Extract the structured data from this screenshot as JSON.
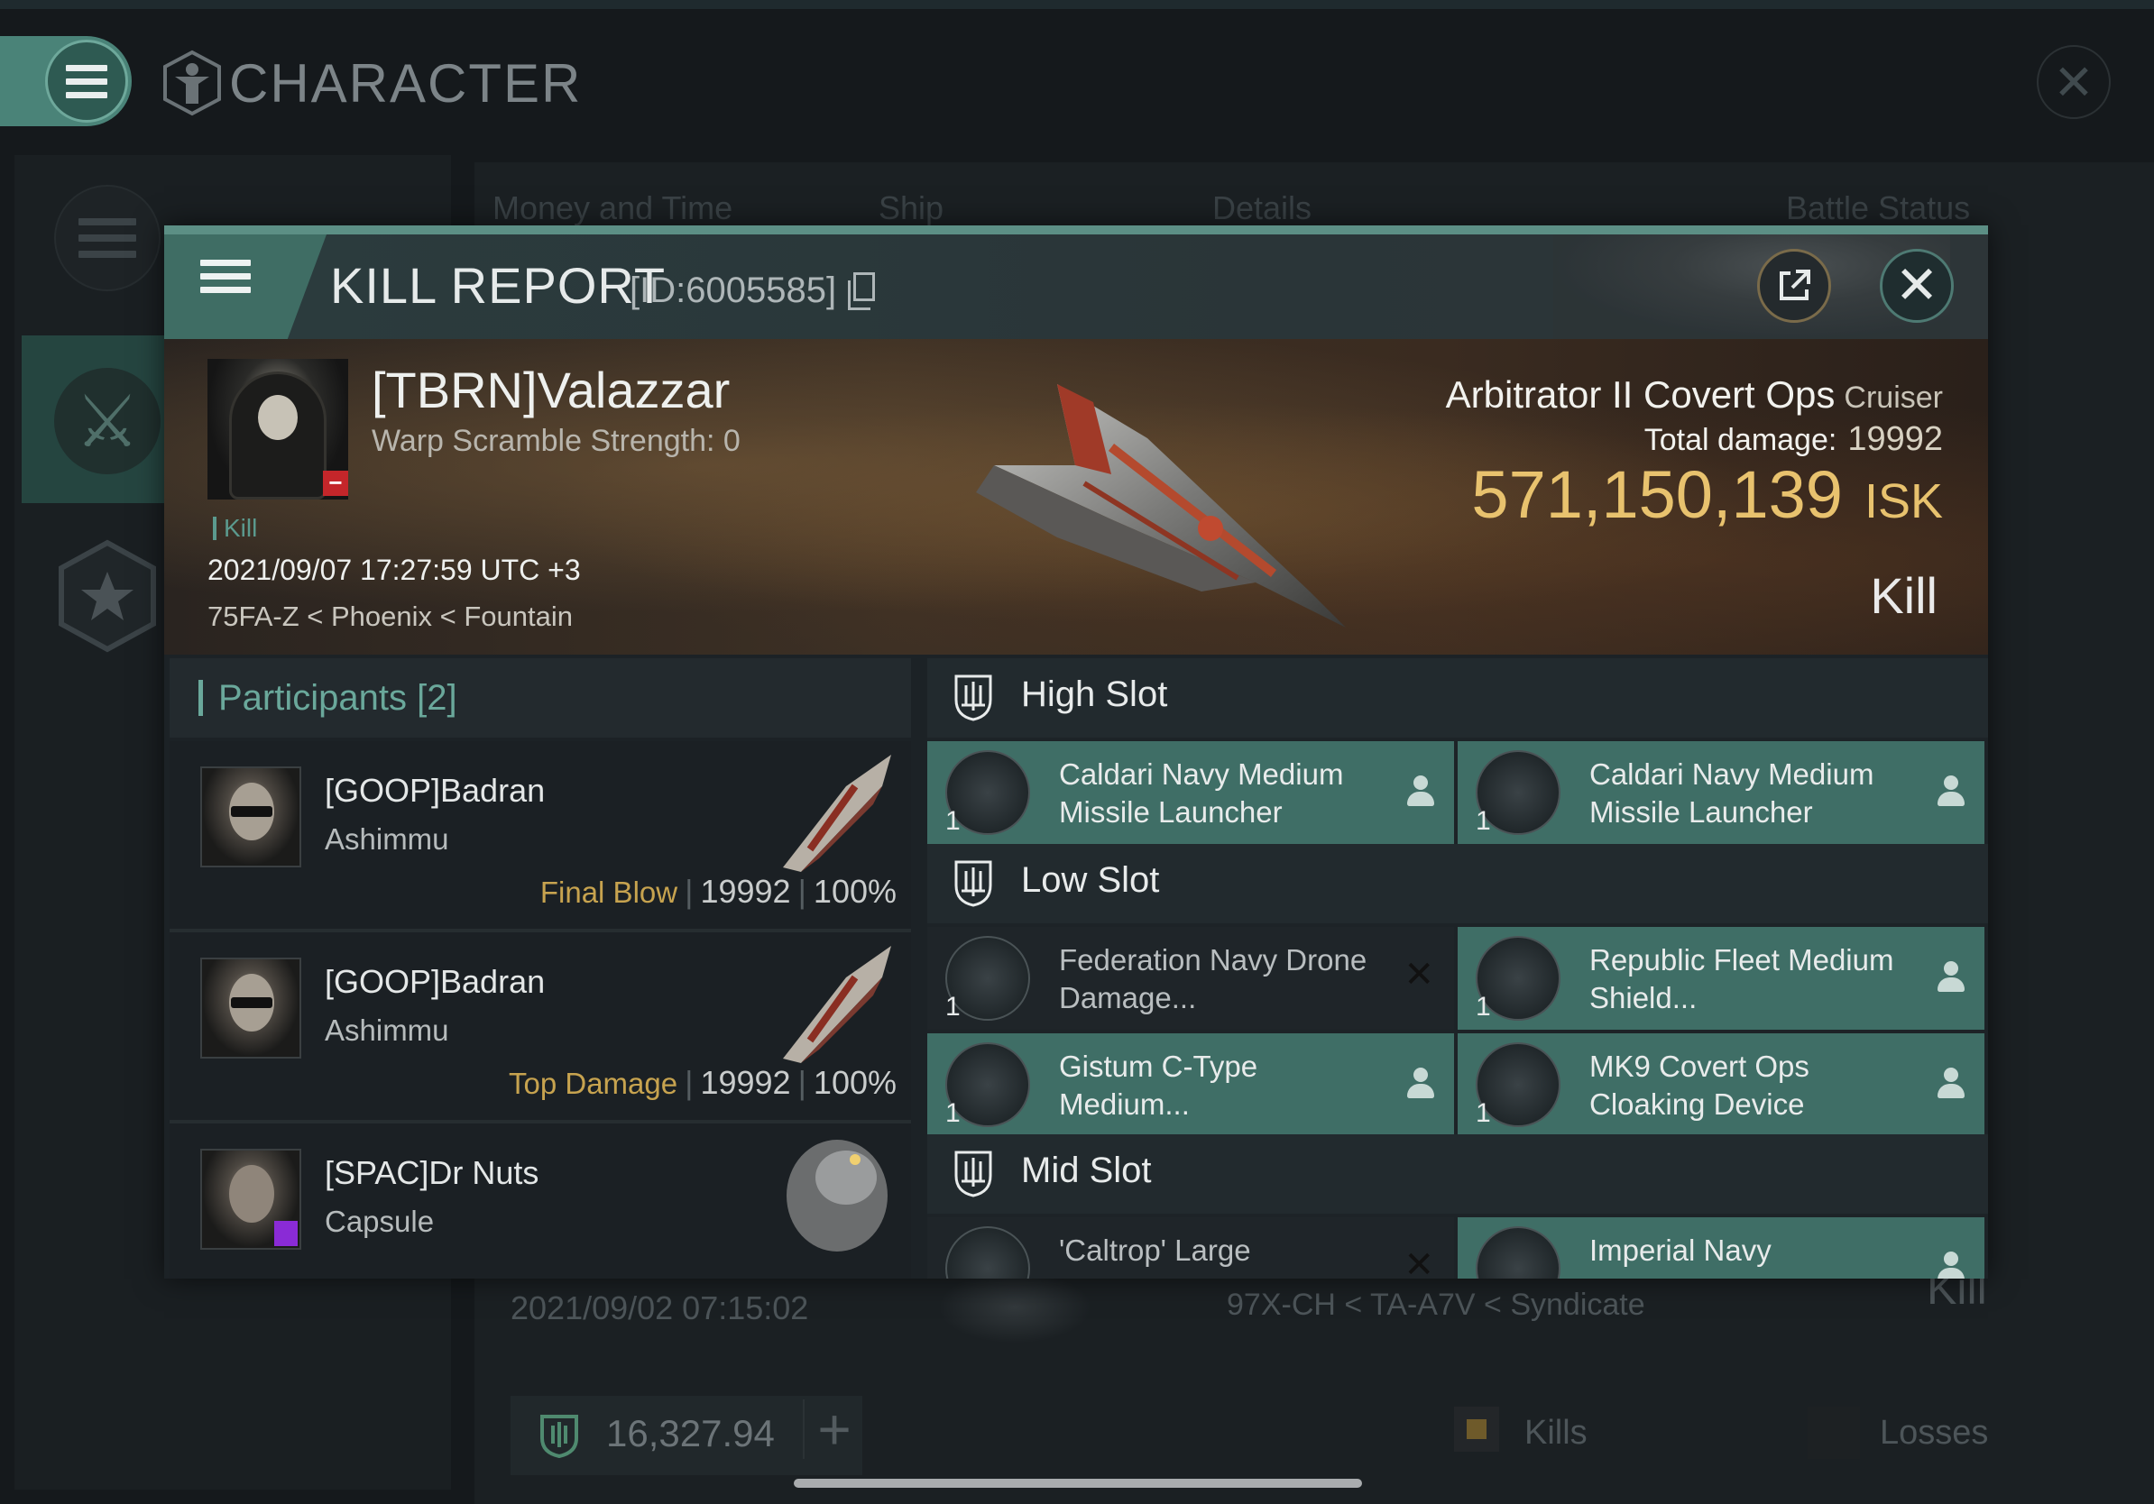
{
  "background_window": {
    "title": "CHARACTER",
    "columns": [
      "Money and Time",
      "Ship",
      "Details",
      "Battle Status"
    ],
    "row": {
      "date": "2021/09/02  07:15:02",
      "location": "97X-CH < TA-A7V < Syndicate",
      "status": "Kill"
    },
    "wallet": "16,327.94",
    "kills_label": "Kills",
    "losses_label": "Losses"
  },
  "kill_report": {
    "title": "KILL REPORT",
    "id": "[ID:6005585]",
    "victim": {
      "name": "[TBRN]Valazzar",
      "warp_scramble": "Warp Scramble Strength: 0",
      "tag": "Kill",
      "timestamp": "2021/09/07 17:27:59 UTC +3",
      "location": "75FA-Z < Phoenix < Fountain"
    },
    "ship": {
      "name": "Arbitrator II Covert Ops",
      "class": "Cruiser",
      "total_damage_label": "Total damage:",
      "total_damage": "19992",
      "isk_value": "571,150,139",
      "isk_unit": "ISK",
      "outcome": "Kill"
    },
    "participants": {
      "title": "Participants",
      "count": "[2]",
      "rows": [
        {
          "name": "[GOOP]Badran",
          "ship": "Ashimmu",
          "label": "Final Blow",
          "damage": "19992",
          "percent": "100%"
        },
        {
          "name": "[GOOP]Badran",
          "ship": "Ashimmu",
          "label": "Top Damage",
          "damage": "19992",
          "percent": "100%"
        },
        {
          "name": "[SPAC]Dr Nuts",
          "ship": "Capsule",
          "label": "",
          "damage": "",
          "percent": ""
        }
      ]
    },
    "slots": {
      "high": {
        "label": "High Slot",
        "items": [
          {
            "qty": "1",
            "name": "Caldari Navy Medium Missile Launcher",
            "state": "dropped"
          },
          {
            "qty": "1",
            "name": "Caldari Navy Medium Missile Launcher",
            "state": "dropped"
          }
        ]
      },
      "low": {
        "label": "Low Slot",
        "items": [
          {
            "qty": "1",
            "name": "Federation Navy Drone Damage...",
            "state": "destroyed"
          },
          {
            "qty": "1",
            "name": "Republic Fleet Medium Shield...",
            "state": "dropped"
          },
          {
            "qty": "1",
            "name": "Gistum C-Type Medium...",
            "state": "dropped"
          },
          {
            "qty": "1",
            "name": "MK9 Covert Ops Cloaking Device",
            "state": "dropped"
          }
        ]
      },
      "mid": {
        "label": "Mid Slot",
        "items": [
          {
            "qty": "1",
            "name": "'Caltrop' Large",
            "state": "destroyed"
          },
          {
            "qty": "1",
            "name": "Imperial Navy",
            "state": "dropped"
          }
        ]
      }
    }
  },
  "colors": {
    "accent": "#5c8f85",
    "isk_gold": "#e8c26e",
    "final_blow_gold": "#c7a34f",
    "item_active": "#3f6e66"
  }
}
